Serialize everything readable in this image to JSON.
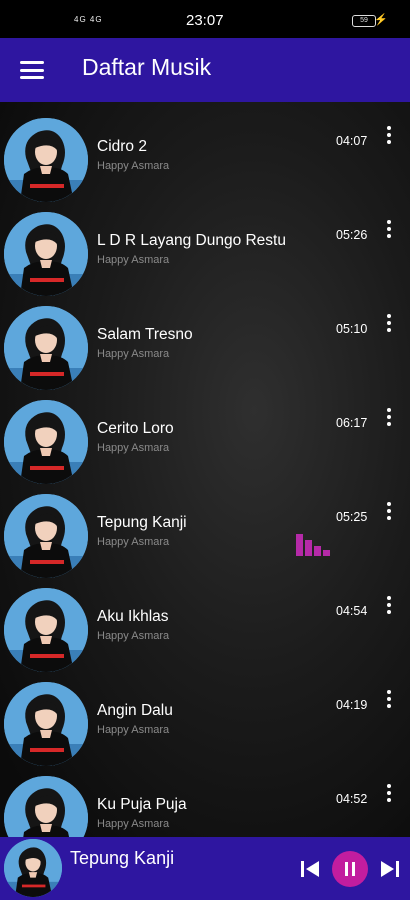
{
  "status_bar": {
    "time": "23:07",
    "signal": "4G 4G",
    "battery": "59"
  },
  "app_bar": {
    "title": "Daftar Musik"
  },
  "songs": [
    {
      "title": "Cidro 2",
      "artist": "Happy Asmara",
      "duration": "04:07"
    },
    {
      "title": "L D R Layang Dungo Restu",
      "artist": "Happy Asmara",
      "duration": "05:26"
    },
    {
      "title": "Salam Tresno",
      "artist": "Happy Asmara",
      "duration": "05:10"
    },
    {
      "title": "Cerito Loro",
      "artist": "Happy Asmara",
      "duration": "06:17"
    },
    {
      "title": "Tepung Kanji",
      "artist": "Happy Asmara",
      "duration": "05:25"
    },
    {
      "title": "Aku Ikhlas",
      "artist": "Happy Asmara",
      "duration": "04:54"
    },
    {
      "title": "Angin Dalu",
      "artist": "Happy Asmara",
      "duration": "04:19"
    },
    {
      "title": "Ku Puja Puja",
      "artist": "Happy Asmara",
      "duration": "04:52"
    }
  ],
  "now_playing": {
    "title": "Tepung Kanji"
  },
  "colors": {
    "app_bar": "#2e16a0",
    "accent": "#c21d9f",
    "equalizer": "#b52aa8"
  }
}
